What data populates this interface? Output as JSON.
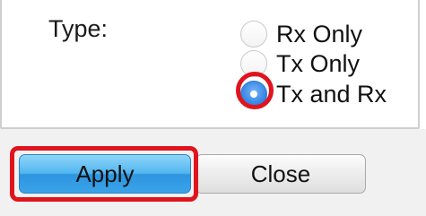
{
  "type_field": {
    "label": "Type:",
    "options": [
      {
        "label": "Rx Only",
        "selected": false
      },
      {
        "label": "Tx Only",
        "selected": false
      },
      {
        "label": "Tx and Rx",
        "selected": true
      }
    ]
  },
  "buttons": {
    "apply_label": "Apply",
    "close_label": "Close"
  },
  "colors": {
    "highlight": "#e0141c",
    "primary_button": "#3aa3e8",
    "radio_selected": "#2e79d8"
  }
}
